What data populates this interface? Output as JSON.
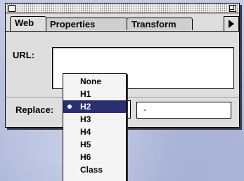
{
  "window": {
    "tabs": [
      {
        "label": "Web",
        "active": true
      },
      {
        "label": "Properties",
        "active": false
      },
      {
        "label": "Transform",
        "active": false
      }
    ],
    "scroll_icon": "triangle-right-icon"
  },
  "form": {
    "url_label": "URL:",
    "url_value": "",
    "replace_label": "Replace:",
    "replace_value": "-"
  },
  "popup_menu": {
    "items": [
      "None",
      "H1",
      "H2",
      "H3",
      "H4",
      "H5",
      "H6",
      "Class"
    ],
    "selected": "H2",
    "selected_bg": "#2a2f72"
  }
}
